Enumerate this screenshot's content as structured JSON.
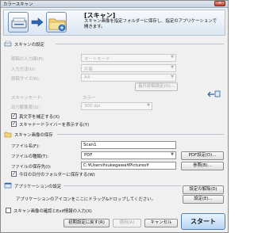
{
  "window": {
    "title": "カラースキャン",
    "close_label": "×"
  },
  "header": {
    "title": "[スキャン]",
    "description": "スキャン画像を指定フォルダーに保存し、指定のアプリケーションで開きます。",
    "icons": [
      "scanner-icon",
      "arrow-icon",
      "folder-icon"
    ]
  },
  "scan_settings": {
    "section_label": "スキャンの設定",
    "section_icon": "scanner-icon",
    "paper_source": {
      "label": "原稿の入力面(P):",
      "value": "オートモード"
    },
    "input_method": {
      "label": "入力方法(U):",
      "value": "片面"
    },
    "paper_size": {
      "label": "原稿サイズ(R):",
      "value": "A4"
    },
    "long_paper_button": "長尺原稿設定(O)...",
    "scan_mode": {
      "label": "スキャンモード:",
      "value": "カラー"
    },
    "resolution": {
      "label": "出力解像度(S):",
      "value": "300 dpi"
    },
    "straighten_checkbox": {
      "label": "真文字を補正する(X)",
      "checked": true
    },
    "show_driver_checkbox": {
      "label": "スキャナードライバーを表示する(Y)",
      "checked": true
    },
    "link_icon": "link-icon"
  },
  "save_settings": {
    "section_label": "スキャン画像の保存",
    "section_icon": "save-icon",
    "file_name": {
      "label": "ファイル名(F):",
      "value": "Scan1"
    },
    "file_type": {
      "label": "ファイルの種類(T):",
      "value": "PDF"
    },
    "pdf_settings_button": "PDF設定(D)...",
    "save_location": {
      "label": "ファイルの保存先(I):",
      "value": "C:¥Users¥sukegawa¥Pictures¥"
    },
    "browse_button": "参照(B)...",
    "date_subfolder_checkbox": {
      "label": "今日の日付のフォルダーに保存する(W)",
      "checked": true
    }
  },
  "app_settings": {
    "section_label": "アプリケーションの設定",
    "section_icon": "app-icon",
    "hint": "アプリケーションのアイコンをここにドラッグ&ドロップしてください。",
    "clear_button": "設定の解除(D)",
    "settings_button": "設定(E)..."
  },
  "footer": {
    "confirm_checkbox": {
      "label": "スキャン画像の確認とExif情報の入力(X)",
      "checked": false
    },
    "reset_button": "初期設定に戻す(R)",
    "apply_button": "適用(A)",
    "cancel_button": "キャンセル",
    "start_button": "スタート"
  },
  "colors": {
    "accent": "#4f7fb3",
    "header_bg": "#dbe6f1",
    "start_bg": "#b6d4f2"
  }
}
